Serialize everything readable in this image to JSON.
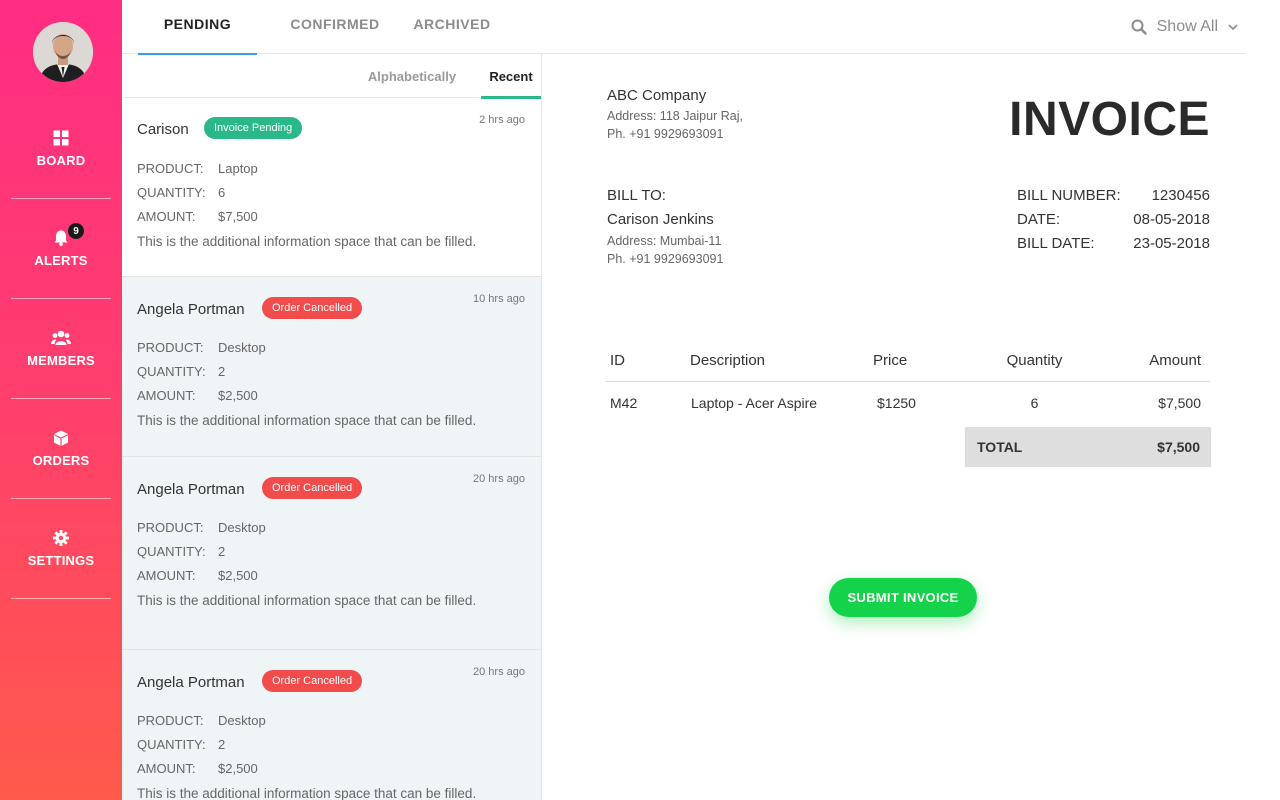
{
  "colors": {
    "sidebar_top": "#ff2d83",
    "sidebar_bottom": "#ff5a4b",
    "tab_active": "#3a9be8",
    "pending": "#2ab88a",
    "cancelled": "#f24b4b",
    "submit": "#14d24a"
  },
  "sidebar": {
    "avatar": "avatar",
    "items": [
      {
        "label": "BOARD",
        "icon": "grid-icon"
      },
      {
        "label": "ALERTS",
        "icon": "bell-icon",
        "badge": "9"
      },
      {
        "label": "MEMBERS",
        "icon": "users-icon"
      },
      {
        "label": "ORDERS",
        "icon": "box-icon"
      },
      {
        "label": "SETTINGS",
        "icon": "gear-icon"
      }
    ]
  },
  "tabs": [
    {
      "label": "PENDING",
      "active": true
    },
    {
      "label": "CONFIRMED",
      "active": false
    },
    {
      "label": "ARCHIVED",
      "active": false
    }
  ],
  "filter": {
    "label": "Show All",
    "icon": "search-icon"
  },
  "sort": {
    "alpha": "Alphabetically",
    "recent": "Recent",
    "active": "Recent"
  },
  "list_labels": {
    "product": "PRODUCT:",
    "quantity": "QUANTITY:",
    "amount": "AMOUNT:"
  },
  "cards": [
    {
      "name": "Carison",
      "status": "Invoice Pending",
      "time": "2 hrs ago",
      "product": "Laptop",
      "quantity": "6",
      "amount": "$7,500",
      "info": "This is the additional information space that can be filled."
    },
    {
      "name": "Angela Portman",
      "status": "Order Cancelled",
      "time": "10 hrs ago",
      "product": "Desktop",
      "quantity": "2",
      "amount": "$2,500",
      "info": "This is the additional information space that can be filled."
    },
    {
      "name": "Angela Portman",
      "status": "Order Cancelled",
      "time": "20 hrs ago",
      "product": "Desktop",
      "quantity": "2",
      "amount": "$2,500",
      "info": "This is the additional information space that can be filled."
    },
    {
      "name": "Angela Portman",
      "status": "Order Cancelled",
      "time": "20 hrs ago",
      "product": "Desktop",
      "quantity": "2",
      "amount": "$2,500",
      "info": "This is the additional information space that can be filled."
    }
  ],
  "invoice": {
    "company": "ABC Company",
    "company_address": "Address: 118 Jaipur Raj,",
    "company_phone": "Ph. +91 9929693091",
    "title": "INVOICE",
    "bill_to_label": "BILL TO:",
    "client_name": "Carison Jenkins",
    "client_address": "Address: Mumbai-11",
    "client_phone": "Ph. +91 9929693091",
    "bill_number_label": "BILL NUMBER:",
    "bill_number": "1230456",
    "date_label": "DATE:",
    "date": "08-05-2018",
    "bill_date_label": "BILL DATE:",
    "bill_date": "23-05-2018",
    "columns": [
      "ID",
      "Description",
      "Price",
      "Quantity",
      "Amount"
    ],
    "rows": [
      {
        "id": "M42",
        "description": "Laptop - Acer Aspire",
        "price": "$1250",
        "quantity": "6",
        "amount": "$7,500"
      }
    ],
    "total_label": "TOTAL",
    "total": "$7,500",
    "submit_label": "SUBMIT INVOICE"
  }
}
